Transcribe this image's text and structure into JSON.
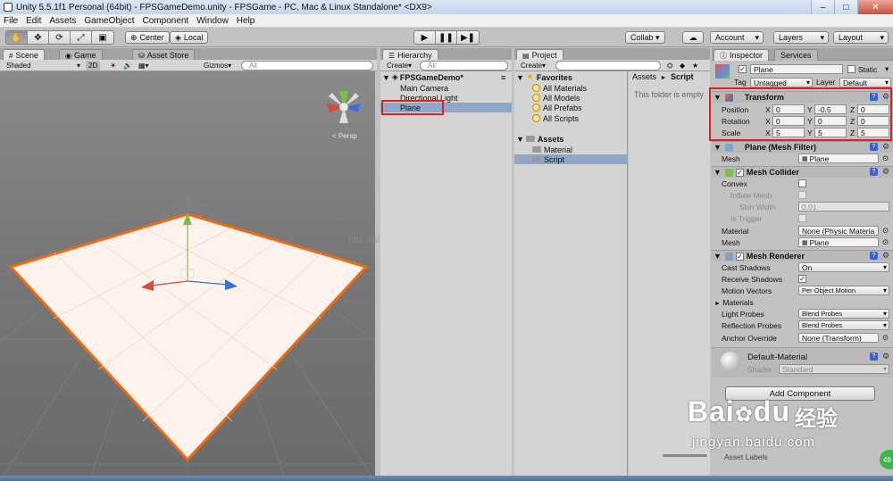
{
  "window": {
    "title": "Unity 5.5.1f1 Personal (64bit) - FPSGameDemo.unity - FPSGame - PC, Mac & Linux Standalone* <DX9>",
    "minimize": "–",
    "maximize": "□",
    "close": "✕"
  },
  "menu": [
    "File",
    "Edit",
    "Assets",
    "GameObject",
    "Component",
    "Window",
    "Help"
  ],
  "toolbar": {
    "pivot": "Center",
    "space": "Local",
    "collab": "Collab ▾",
    "account": "Account",
    "layers": "Layers",
    "layout": "Layout"
  },
  "scene": {
    "tabs": [
      "Scene",
      "Game",
      "Asset Store"
    ],
    "shading": "Shaded",
    "mode_2d": "2D",
    "gizmos": "Gizmos",
    "search_placeholder": "All",
    "persp": "< Persp"
  },
  "hierarchy": {
    "tab": "Hierarchy",
    "create": "Create",
    "search_placeholder": "All",
    "scene_name": "FPSGameDemo*",
    "items": [
      "Main Camera",
      "Directional Light",
      "Plane"
    ],
    "selected": "Plane"
  },
  "project": {
    "tab": "Project",
    "create": "Create",
    "favorites_label": "Favorites",
    "favorites": [
      "All Materials",
      "All Models",
      "All Prefabs",
      "All Scripts"
    ],
    "assets_label": "Assets",
    "assets": [
      "Material",
      "Script"
    ],
    "breadcrumb_root": "Assets",
    "breadcrumb_sep": "►",
    "breadcrumb_leaf": "Script",
    "empty_message": "This folder is empty"
  },
  "inspector": {
    "tabs": [
      "Inspector",
      "Services"
    ],
    "object_name": "Plane",
    "static_label": "Static",
    "tag_label": "Tag",
    "tag_value": "Untagged",
    "layer_label": "Layer",
    "layer_value": "Default",
    "transform": {
      "title": "Transform",
      "rows": [
        {
          "label": "Position",
          "x": "0",
          "y": "-0.5",
          "z": "0"
        },
        {
          "label": "Rotation",
          "x": "0",
          "y": "0",
          "z": "0"
        },
        {
          "label": "Scale",
          "x": "5",
          "y": "5",
          "z": "5"
        }
      ]
    },
    "mesh_filter": {
      "title": "Plane (Mesh Filter)",
      "mesh_label": "Mesh",
      "mesh_value": "Plane"
    },
    "mesh_collider": {
      "title": "Mesh Collider",
      "convex": "Convex",
      "inflate": "Inflate Mesh",
      "skin": "Skin Width",
      "skin_value": "0.01",
      "trigger": "Is Trigger",
      "material_label": "Material",
      "material_value": "None (Physic Materia",
      "mesh_label": "Mesh",
      "mesh_value": "Plane"
    },
    "mesh_renderer": {
      "title": "Mesh Renderer",
      "rows": [
        {
          "label": "Cast Shadows",
          "value": "On"
        },
        {
          "label": "Receive Shadows",
          "value": "✓"
        },
        {
          "label": "Motion Vectors",
          "value": "Per Object Motion"
        },
        {
          "label": "Materials",
          "value": ""
        },
        {
          "label": "Light Probes",
          "value": "Blend Probes"
        },
        {
          "label": "Reflection Probes",
          "value": "Blend Probes"
        },
        {
          "label": "Anchor Override",
          "value": "None (Transform)"
        }
      ]
    },
    "material": {
      "name": "Default-Material",
      "shader_label": "Shader",
      "shader_value": "Standard"
    },
    "add_component": "Add Component",
    "footer": "Asset Labels"
  },
  "overlay": {
    "watermark": "http://blog.csdn.net/...",
    "baidu_logo": "Bai",
    "baidu_logo_tail": "du",
    "baidu_cn": "经验",
    "baidu_url": "jingyan.baidu.com",
    "badge": "49"
  },
  "colors": {
    "selection_red": "#e02020",
    "plane_outline": "#f06a12",
    "plane_fill": "#fdf3ec"
  }
}
